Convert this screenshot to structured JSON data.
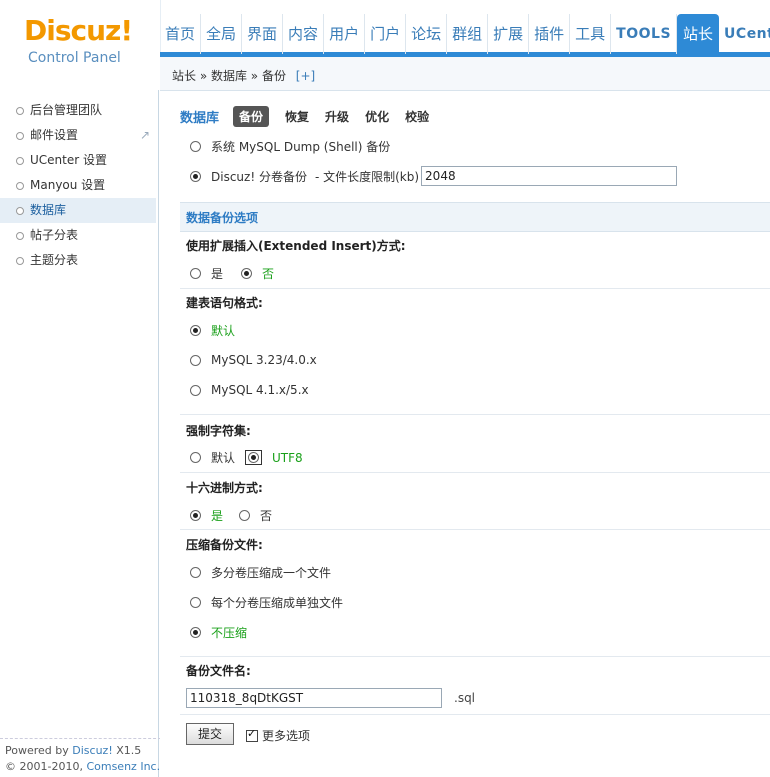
{
  "logo": {
    "title": "Discuz!",
    "subtitle": "Control Panel"
  },
  "nav": {
    "items": [
      {
        "label": "首页"
      },
      {
        "label": "全局"
      },
      {
        "label": "界面"
      },
      {
        "label": "内容"
      },
      {
        "label": "用户"
      },
      {
        "label": "门户"
      },
      {
        "label": "论坛"
      },
      {
        "label": "群组"
      },
      {
        "label": "扩展"
      },
      {
        "label": "插件"
      },
      {
        "label": "工具"
      },
      {
        "label": "TOOLS"
      },
      {
        "label": "站长"
      },
      {
        "label": "UCenter"
      }
    ],
    "active_index": 12
  },
  "breadcrumb": {
    "text": "站长 » 数据库 » 备份",
    "add": "[+]"
  },
  "sidebar": {
    "items": [
      {
        "label": "后台管理团队"
      },
      {
        "label": "邮件设置"
      },
      {
        "label": "UCenter 设置"
      },
      {
        "label": "Manyou 设置"
      },
      {
        "label": "数据库"
      },
      {
        "label": "帖子分表"
      },
      {
        "label": "主题分表"
      }
    ],
    "selected_index": 4,
    "footer": {
      "powered_prefix": "Powered by ",
      "powered_brand": "Discuz!",
      "version": " X1.5",
      "copyright_prefix": "© 2001-2010, ",
      "company": "Comsenz Inc."
    }
  },
  "main": {
    "section_title": "数据库",
    "tabs": [
      {
        "label": "备份"
      },
      {
        "label": "恢复"
      },
      {
        "label": "升级"
      },
      {
        "label": "优化"
      },
      {
        "label": "校验"
      }
    ],
    "backup_type": {
      "option_shell": "系统 MySQL Dump (Shell) 备份",
      "option_discuz": "Discuz! 分卷备份",
      "size_limit_label": "- 文件长度限制(kb)",
      "size_limit_value": "2048"
    },
    "options_title": "数据备份选项",
    "extended_insert": {
      "label": "使用扩展插入(Extended Insert)方式:",
      "yes": "是",
      "no": "否"
    },
    "create_syntax": {
      "label": "建表语句格式:",
      "default": "默认",
      "mysql323": "MySQL 3.23/4.0.x",
      "mysql41": "MySQL 4.1.x/5.x"
    },
    "charset": {
      "label": "强制字符集:",
      "default": "默认",
      "utf8": "UTF8"
    },
    "hex": {
      "label": "十六进制方式:",
      "yes": "是",
      "no": "否"
    },
    "compress": {
      "label": "压缩备份文件:",
      "multi_one": "多分卷压缩成一个文件",
      "each": "每个分卷压缩成单独文件",
      "none": "不压缩"
    },
    "filename": {
      "label": "备份文件名:",
      "value": "110318_8qDtKGST",
      "ext": ".sql"
    },
    "submit_label": "提交",
    "more_options": "更多选项"
  }
}
